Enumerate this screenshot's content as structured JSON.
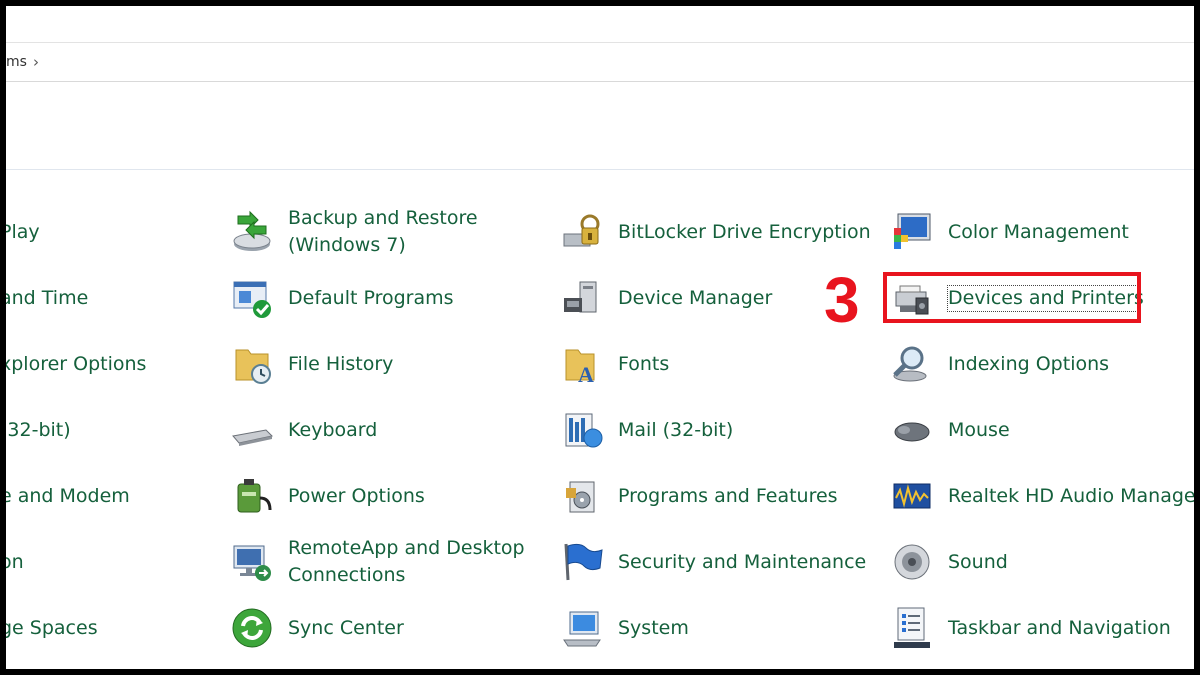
{
  "breadcrumb": {
    "partial": "ms",
    "chevron": "›"
  },
  "step_number": "3",
  "columns": [
    {
      "col": 0,
      "items": [
        {
          "label": "Play"
        },
        {
          "label": "and Time"
        },
        {
          "label": "xplorer Options"
        },
        {
          "label": "(32-bit)"
        },
        {
          "label": "e and Modem"
        },
        {
          "label": "on"
        },
        {
          "label": "ge Spaces"
        }
      ]
    },
    {
      "col": 1,
      "items": [
        {
          "label": "Backup and Restore\n(Windows 7)",
          "icon": "backup-restore-icon"
        },
        {
          "label": "Default Programs",
          "icon": "default-programs-icon"
        },
        {
          "label": "File History",
          "icon": "file-history-icon"
        },
        {
          "label": "Keyboard",
          "icon": "keyboard-icon"
        },
        {
          "label": "Power Options",
          "icon": "power-options-icon"
        },
        {
          "label": "RemoteApp and Desktop\nConnections",
          "icon": "remoteapp-icon"
        },
        {
          "label": "Sync Center",
          "icon": "sync-center-icon"
        }
      ]
    },
    {
      "col": 2,
      "items": [
        {
          "label": "BitLocker Drive Encryption",
          "icon": "bitlocker-icon"
        },
        {
          "label": "Device Manager",
          "icon": "device-manager-icon"
        },
        {
          "label": "Fonts",
          "icon": "fonts-icon"
        },
        {
          "label": "Mail (32-bit)",
          "icon": "mail-icon"
        },
        {
          "label": "Programs and Features",
          "icon": "programs-features-icon"
        },
        {
          "label": "Security and Maintenance",
          "icon": "security-maintenance-icon"
        },
        {
          "label": "System",
          "icon": "system-icon"
        }
      ]
    },
    {
      "col": 3,
      "items": [
        {
          "label": "Color Management",
          "icon": "color-management-icon"
        },
        {
          "label": "Devices and Printers",
          "icon": "devices-printers-icon"
        },
        {
          "label": "Indexing Options",
          "icon": "indexing-options-icon"
        },
        {
          "label": "Mouse",
          "icon": "mouse-icon"
        },
        {
          "label": "Realtek HD Audio Manager",
          "icon": "realtek-audio-icon"
        },
        {
          "label": "Sound",
          "icon": "sound-icon"
        },
        {
          "label": "Taskbar and Navigation",
          "icon": "taskbar-navigation-icon"
        }
      ]
    }
  ]
}
